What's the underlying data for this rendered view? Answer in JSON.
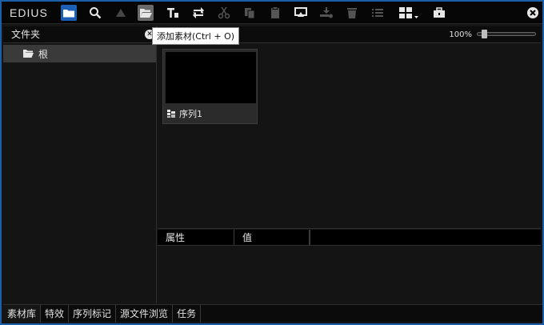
{
  "app": {
    "logo": "EDIUS"
  },
  "toolbar": {
    "buttons": [
      {
        "name": "folder-view",
        "icon": "folder-icon",
        "state": "active"
      },
      {
        "name": "search",
        "icon": "search-icon"
      },
      {
        "name": "up-level",
        "icon": "triangle-up-icon",
        "state": "disabled"
      },
      {
        "name": "add-clip",
        "icon": "open-folder-icon",
        "state": "hover"
      },
      {
        "name": "add-title",
        "icon": "title-icon"
      },
      {
        "name": "replace",
        "icon": "replace-icon"
      },
      {
        "name": "cut",
        "icon": "scissors-icon",
        "state": "disabled"
      },
      {
        "name": "copy",
        "icon": "copy-icon",
        "state": "disabled"
      },
      {
        "name": "paste",
        "icon": "paste-icon",
        "state": "disabled"
      },
      {
        "name": "send-to-player",
        "icon": "monitor-icon"
      },
      {
        "name": "add-to-timeline",
        "icon": "timeline-add-icon",
        "state": "disabled"
      },
      {
        "name": "delete",
        "icon": "trash-icon",
        "state": "disabled"
      },
      {
        "name": "list-view",
        "icon": "list-icon",
        "state": "disabled"
      },
      {
        "name": "view-mode",
        "icon": "grid-icon"
      },
      {
        "name": "toolbox",
        "icon": "toolbox-icon"
      }
    ],
    "tooltip": "添加素材(Ctrl + O)"
  },
  "folder_pane": {
    "title": "文件夹",
    "tree": [
      {
        "label": "根",
        "icon": "folder-icon",
        "selected": true
      }
    ]
  },
  "clip_view": {
    "zoom": "100%",
    "zoom_level": 0.08,
    "clips": [
      {
        "label": "序列1",
        "icon": "sequence-icon"
      }
    ]
  },
  "properties": {
    "columns": [
      "属性",
      "值"
    ]
  },
  "tabs": [
    {
      "label": "素材库",
      "active": true
    },
    {
      "label": "特效"
    },
    {
      "label": "序列标记"
    },
    {
      "label": "源文件浏览"
    },
    {
      "label": "任务"
    }
  ],
  "colors": {
    "accent": "#1d5fb4",
    "background": "#151515",
    "text": "#e6e6e6"
  }
}
